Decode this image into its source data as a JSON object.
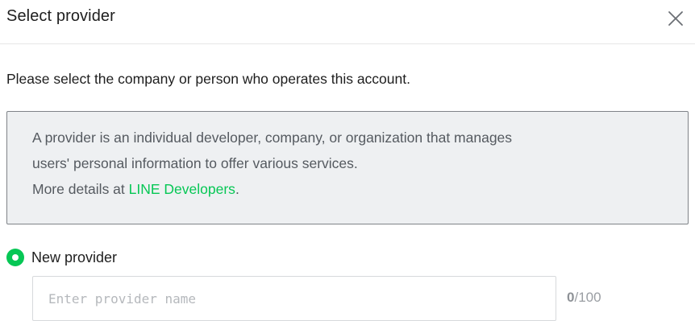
{
  "dialog": {
    "title": "Select provider",
    "close_icon": "close-icon"
  },
  "intro_text": "Please select the company or person who operates this account.",
  "info_box": {
    "line1": "A provider is an individual developer, company, or organization that manages",
    "line2": "users' personal information to offer various services.",
    "line3_prefix": "More details at ",
    "link_text": "LINE Developers",
    "line3_suffix": "."
  },
  "options": {
    "new_provider_label": "New provider",
    "new_provider_selected": true
  },
  "provider_name": {
    "value": "",
    "placeholder": "Enter provider name",
    "count": "0",
    "max": "/100"
  },
  "colors": {
    "accent": "#06c755",
    "info_bg": "#eef0f2",
    "info_border": "#7f8388"
  }
}
